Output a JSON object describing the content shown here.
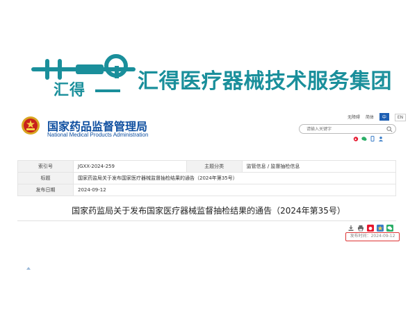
{
  "brand": {
    "logo_text": "汇得",
    "company_name": "汇得医疗器械技术服务集团",
    "accent": "#1a8f9b"
  },
  "site": {
    "title": "国家药品监督管理局",
    "subtitle": "National Medical Products Administration",
    "title_color": "#0f4fa0",
    "toplinks": {
      "accessibility": "无障碍",
      "simplified": "简体",
      "lang_zh": "中",
      "lang_en": "EN"
    },
    "search": {
      "placeholder": "请输入关键字"
    },
    "social_icons": [
      "weibo-icon",
      "wechat-icon",
      "mobile-icon",
      "user-icon"
    ]
  },
  "info": {
    "rows": [
      {
        "label": "索引号",
        "value": "JGXX-2024-259",
        "label2": "主题分类",
        "value2": "监管信息 / 监督抽检信息"
      },
      {
        "label": "标题",
        "value": "国家药监局关于发布国家医疗器械监督抽检结果的通告（2024年第35号）"
      },
      {
        "label": "发布日期",
        "value": "2024-09-12"
      }
    ]
  },
  "document": {
    "title": "国家药监局关于发布国家医疗器械监督抽检结果的通告（2024年第35号）",
    "publish_date_text": "发布时间：2024-09-12",
    "highlight_color": "#d33333"
  }
}
